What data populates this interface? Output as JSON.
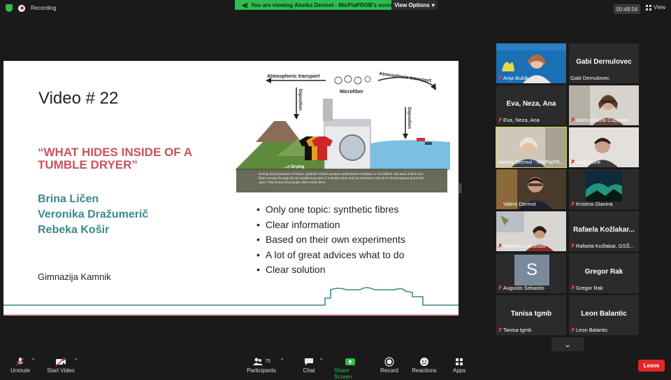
{
  "top": {
    "recording": "Recording",
    "banner": "You are viewing Alenka Dermol - MicPlaPROB's screen",
    "view_options": "View Options",
    "timer": "00:48:56",
    "view": "View"
  },
  "slide": {
    "title": "Video # 22",
    "quote": "“WHAT HIDES INSIDE OF A TUMBLE DRYER”",
    "authors": [
      "Brina Ličen",
      "Veronika Dražumerič",
      "Rebeka Košir"
    ],
    "school": "Gimnazija Kamnik",
    "bullets": [
      "Only one topic: synthetic fibres",
      "Clear information",
      "Based on their own experiments",
      "A lot of great advices what to do",
      "Clear solution"
    ],
    "diagram": {
      "atm_left": "Atmospheric transport",
      "atm_right": "Atmospheric transport",
      "deposition_left": "Deposition",
      "deposition_right": "Deposition",
      "microfiber": "Microfiber",
      "drying": "...n Drying",
      "caption": "During drying because of friction, synthetic clothes produce small pieces of plastic or microfibers. Because of their size fibers escape through the air conditioning tube of a tumble dryer and are released in the air in closed spaces and in the open. That means that people often inhale them."
    }
  },
  "participants": [
    {
      "name": "Anja Bubik",
      "big": "",
      "muted": true,
      "video": true
    },
    {
      "name": "Gabi Dernulovec",
      "big": "Gabi Dernulovec",
      "muted": false,
      "video": false
    },
    {
      "name": "Eva, Neza, Ana",
      "big": "Eva, Neza, Ana",
      "muted": true,
      "video": false
    },
    {
      "name": "Maria Grazia Cuppone",
      "big": "",
      "muted": true,
      "video": true
    },
    {
      "name": "Alenka Dermol - MicPlaPR...",
      "big": "",
      "muted": false,
      "video": true
    },
    {
      "name": "Aleš Trunk",
      "big": "",
      "muted": true,
      "video": true
    },
    {
      "name": "Valerij Dermol",
      "big": "",
      "muted": true,
      "video": true
    },
    {
      "name": "Kristina Glavina",
      "big": "",
      "muted": true,
      "video": true
    },
    {
      "name": "Marilena Lincesso",
      "big": "",
      "muted": true,
      "video": true
    },
    {
      "name": "Rafaela Kožlakar, GSŠ...",
      "big": "Rafaela Kožlakar...",
      "muted": true,
      "video": false
    },
    {
      "name": "Augusto Sebastio",
      "big": "S",
      "muted": true,
      "video": false
    },
    {
      "name": "Gregor Rak",
      "big": "Gregor Rak",
      "muted": true,
      "video": false
    },
    {
      "name": "Tanisa tgmb",
      "big": "Tanisa tgmb",
      "muted": true,
      "video": false
    },
    {
      "name": "Leon Balantic",
      "big": "Leon Balantic",
      "muted": true,
      "video": false
    }
  ],
  "toolbar": {
    "unmute": "Unmute",
    "start_video": "Start Video",
    "participants": "Participants",
    "participants_count": "75",
    "chat": "Chat",
    "share_screen": "Share Screen",
    "record": "Record",
    "reactions": "Reactions",
    "apps": "Apps",
    "leave": "Leave"
  },
  "colors": {
    "accent_green": "#2dbd4e",
    "leave_red": "#e02828",
    "teal": "#3a8a8a",
    "rose": "#c9535c",
    "active_border": "#d7d44b"
  }
}
